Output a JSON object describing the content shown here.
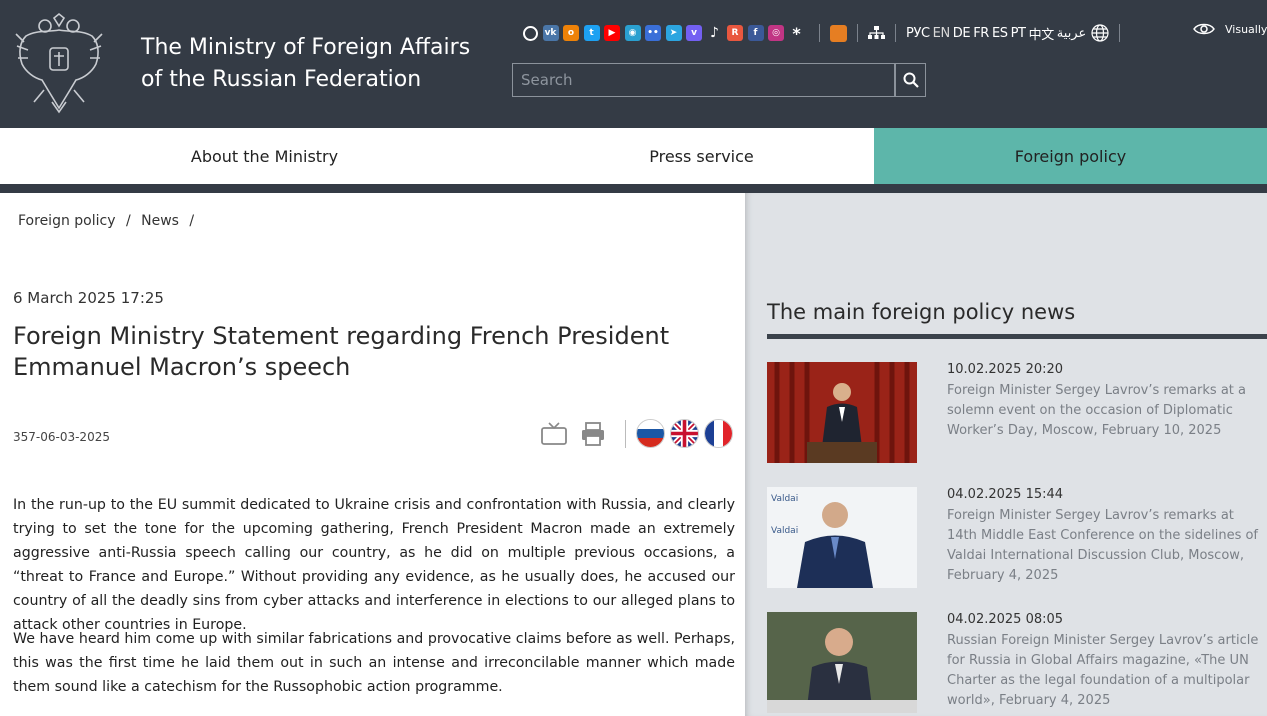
{
  "header": {
    "title_line1": "The Ministry of Foreign Affairs",
    "title_line2": "of the Russian Federation",
    "social_icons": [
      {
        "name": "share-icon",
        "color": "#343b45"
      },
      {
        "name": "vk-icon",
        "color": "#4a76a8"
      },
      {
        "name": "odnoklassniki-icon",
        "color": "#ee8208"
      },
      {
        "name": "twitter-icon",
        "color": "#1da1f2"
      },
      {
        "name": "youtube-icon",
        "color": "#ff0000"
      },
      {
        "name": "map-icon",
        "color": "#2aa0d0"
      },
      {
        "name": "flickr-icon",
        "color": "#3a6fd8"
      },
      {
        "name": "telegram-icon",
        "color": "#2ca5e0"
      },
      {
        "name": "viber-icon",
        "color": "#7360f2"
      },
      {
        "name": "tiktok-icon",
        "color": "#343b45"
      },
      {
        "name": "rutube-icon",
        "color": "#e9573f"
      },
      {
        "name": "facebook-icon",
        "color": "#3b5998"
      },
      {
        "name": "instagram-icon",
        "color": "#c13584"
      },
      {
        "name": "asterisk-icon",
        "color": "#343b45"
      }
    ],
    "languages": [
      "РУС",
      "EN",
      "DE",
      "FR",
      "ES",
      "PT",
      "中文",
      "عربية"
    ],
    "visually_label": "Visually",
    "search_placeholder": "Search"
  },
  "nav": {
    "items": [
      "About the Ministry",
      "Press service",
      "Foreign policy"
    ],
    "active_color": "#5db6aa"
  },
  "article": {
    "breadcrumb": [
      "Foreign policy",
      "/",
      "News",
      "/"
    ],
    "date": "6 March 2025 17:25",
    "title": "Foreign Ministry Statement regarding French President Emmanuel Macron’s speech",
    "doc_number": "357-06-03-2025",
    "paragraphs": [
      "In the run-up to the EU summit dedicated to Ukraine crisis and confrontation with Russia, and clearly trying to set the tone for the upcoming gathering, French President Macron made an extremely aggressive anti-Russia speech calling our country, as he did on multiple previous occasions, a “threat to France and Europe.” Without providing any evidence, as he usually does, he accused our country of all the deadly sins from cyber attacks and interference in elections to our alleged plans to attack other countries in Europe.",
      "We have heard him come up with similar fabrications and provocative claims before as well. Perhaps, this was the first time he laid them out in such an intense and irreconcilable manner which made them sound like a catechism for the Russophobic action programme."
    ]
  },
  "sidebar": {
    "title": "The main foreign policy news",
    "news": [
      {
        "date": "10.02.2025 20:20",
        "text": "Foreign Minister Sergey Lavrov’s remarks at a solemn event on the occasion of Diplomatic Worker’s Day, Moscow, February 10, 2025"
      },
      {
        "date": "04.02.2025 15:44",
        "text": "Foreign Minister Sergey Lavrov’s remarks at 14th Middle East Conference on the sidelines of Valdai International Discussion Club, Moscow, February 4, 2025"
      },
      {
        "date": "04.02.2025 08:05",
        "text": "Russian Foreign Minister Sergey Lavrov’s article for Russia in Global Affairs magazine, «The UN Charter as the legal foundation of a multipolar world», February 4, 2025"
      }
    ]
  }
}
